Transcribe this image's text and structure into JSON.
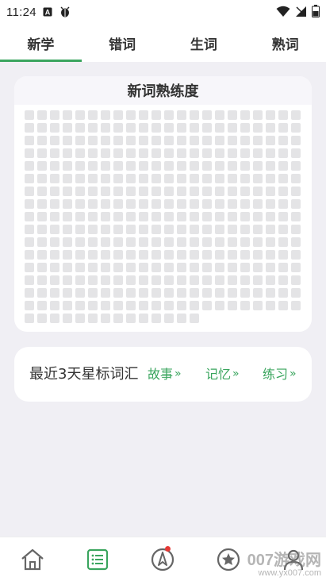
{
  "status_bar": {
    "time": "11:24"
  },
  "tabs": [
    {
      "label": "新学",
      "active": true
    },
    {
      "label": "错词",
      "active": false
    },
    {
      "label": "生词",
      "active": false
    },
    {
      "label": "熟词",
      "active": false
    }
  ],
  "familiarity_card": {
    "title": "新词熟练度",
    "grid": {
      "columns": 22,
      "full_rows": 16,
      "last_row_count": 14
    }
  },
  "starred_card": {
    "title": "最近3天星标词汇",
    "links": [
      {
        "label": "故事"
      },
      {
        "label": "记忆"
      },
      {
        "label": "练习"
      }
    ],
    "chevron": "»"
  },
  "bottom_nav": [
    {
      "icon": "home-icon"
    },
    {
      "icon": "list-icon",
      "active": true
    },
    {
      "icon": "compass-icon",
      "badge": true
    },
    {
      "icon": "star-icon"
    },
    {
      "icon": "profile-icon"
    }
  ],
  "watermark": {
    "main": "007游戏网",
    "url": "www.yx007.com"
  },
  "colors": {
    "accent": "#3aa55e",
    "background": "#f0eff4",
    "cell": "#e4e4e6"
  }
}
